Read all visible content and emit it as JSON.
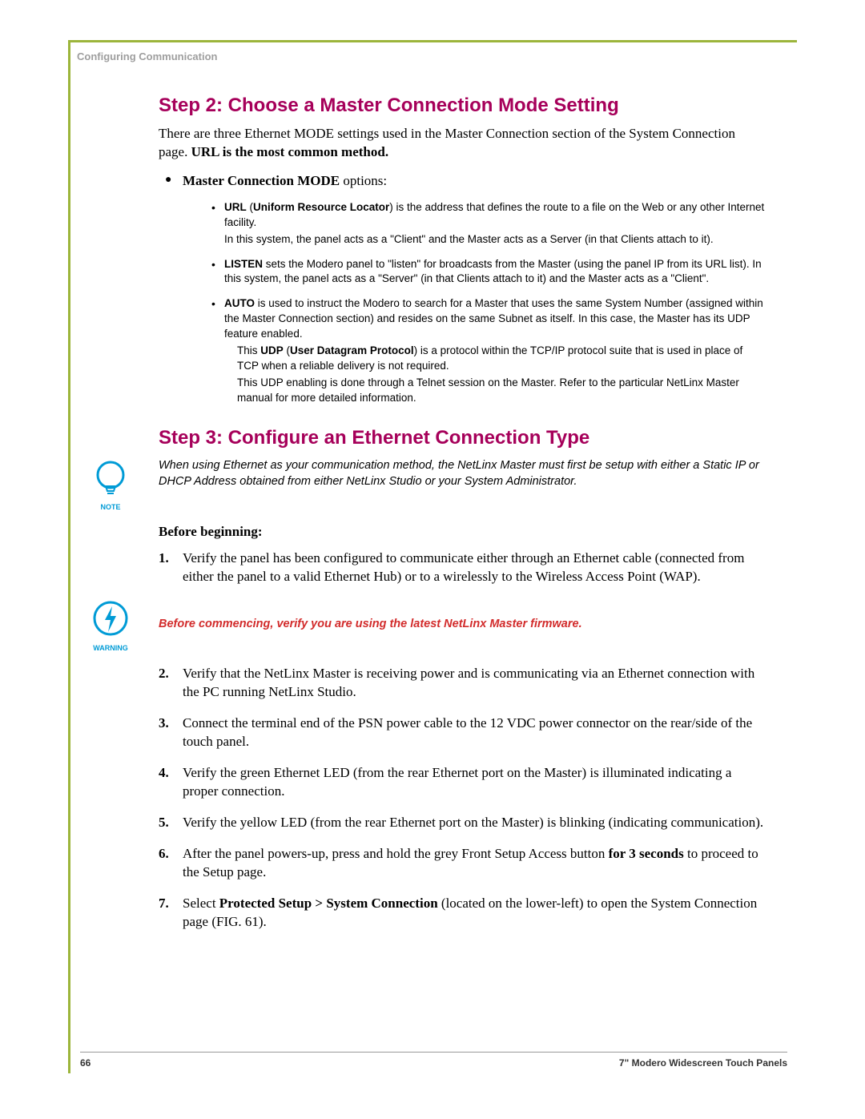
{
  "header": {
    "section": "Configuring Communication"
  },
  "step2": {
    "heading": "Step 2: Choose a Master Connection Mode Setting",
    "intro_a": "There are three Ethernet MODE settings used in the Master Connection section of the System Connection page. ",
    "intro_b": "URL is the most common method.",
    "mode_label_b": "Master Connection MODE",
    "mode_label_tail": " options:",
    "modes": {
      "url_b": "URL",
      "url_paren_b": "Uniform Resource Locator",
      "url_tail": ") is the address that defines the route to a file on the Web or any other Internet facility.",
      "url_sub": "In this system, the panel acts as a \"Client\" and the Master acts as a Server (in that Clients attach to it).",
      "listen_b": "LISTEN",
      "listen_tail": " sets the Modero panel to \"listen\" for broadcasts from the Master (using the panel IP from its URL list). In this system, the panel acts as a \"Server\" (in that Clients attach to it) and the Master acts as a \"Client\".",
      "auto_b": "AUTO",
      "auto_tail": " is used to instruct the Modero to search for a Master that uses the same System Number (assigned within the Master Connection section) and resides on the same Subnet as itself. In this case, the Master has its UDP feature enabled.",
      "auto_sub1_a": "This ",
      "auto_sub1_b": "UDP",
      "auto_sub1_c": " (",
      "auto_sub1_d": "User Datagram Protocol",
      "auto_sub1_e": ") is a protocol within the TCP/IP protocol suite that is used in place of TCP when a reliable delivery is not required.",
      "auto_sub2": "This UDP enabling is done through a Telnet session on the Master. Refer to the particular NetLinx Master manual for more detailed information."
    }
  },
  "step3": {
    "heading": "Step 3: Configure an Ethernet Connection Type",
    "note": "When using Ethernet as your communication method, the NetLinx Master must first be setup with either a Static IP or DHCP Address obtained from either NetLinx Studio or your System Administrator.",
    "note_label": "NOTE",
    "before": "Before beginning:",
    "steps": [
      {
        "n": "1.",
        "a": "Verify the panel has been configured to communicate either through an Ethernet cable (connected from either the panel to a valid Ethernet Hub) or to a wirelessly to the Wireless Access Point (WAP)."
      },
      {
        "n": "2.",
        "a": "Verify that the NetLinx Master is receiving power and is communicating via an Ethernet connection with the PC running NetLinx Studio."
      },
      {
        "n": "3.",
        "a": "Connect the terminal end of the PSN power cable to the 12 VDC power connector on the rear/side of the touch panel."
      },
      {
        "n": "4.",
        "a": "Verify the green Ethernet LED (from the rear Ethernet port on the Master) is illuminated indicating a proper connection."
      },
      {
        "n": "5.",
        "a": "Verify the yellow LED (from the rear Ethernet port on the Master) is blinking (indicating communication)."
      },
      {
        "n": "6.",
        "a": "After the panel powers-up, press and hold the grey Front Setup Access button ",
        "b": "for 3 seconds",
        "c": " to proceed to the Setup page."
      },
      {
        "n": "7.",
        "a": "Select ",
        "b": "Protected Setup > System Connection",
        "c": " (located on the lower-left) to open the System Connection page (FIG. 61)."
      }
    ],
    "warning": "Before commencing, verify you are using the latest NetLinx Master firmware.",
    "warning_label": "WARNING"
  },
  "footer": {
    "page": "66",
    "title": "7\" Modero Widescreen Touch Panels"
  }
}
